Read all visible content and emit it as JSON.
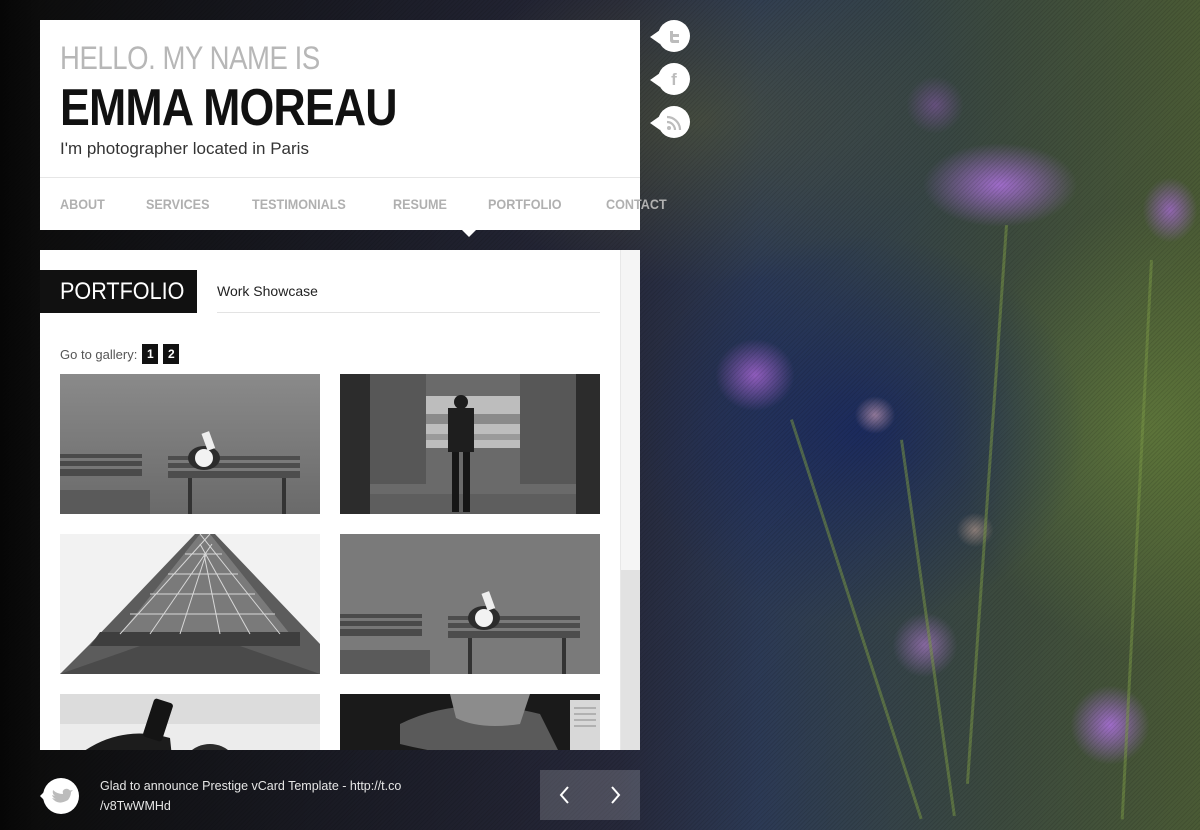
{
  "header": {
    "greeting": "HELLO. MY NAME IS",
    "name": "EMMA MOREAU",
    "tagline": "I'm photographer located in Paris"
  },
  "nav": {
    "items": [
      {
        "label": "ABOUT"
      },
      {
        "label": "SERVICES"
      },
      {
        "label": "TESTIMONIALS"
      },
      {
        "label": "RESUME"
      },
      {
        "label": "PORTFOLIO",
        "active": true
      },
      {
        "label": "CONTACT"
      }
    ]
  },
  "social": {
    "icons": [
      "twitter-icon",
      "facebook-icon",
      "rss-icon"
    ]
  },
  "portfolio": {
    "title": "PORTFOLIO",
    "subtitle": "Work Showcase",
    "gallery_label": "Go to gallery:",
    "gallery_pages": [
      "1",
      "2"
    ]
  },
  "footer": {
    "tweet_line1": "Glad to announce Prestige vCard Template - http://t.co",
    "tweet_line2": "/v8TwWMHd",
    "prev_icon": "chevron-left-icon",
    "next_icon": "chevron-right-icon"
  },
  "colors": {
    "panel": "#ffffff",
    "accent": "#111111",
    "nav_text": "#b0b0b0"
  }
}
